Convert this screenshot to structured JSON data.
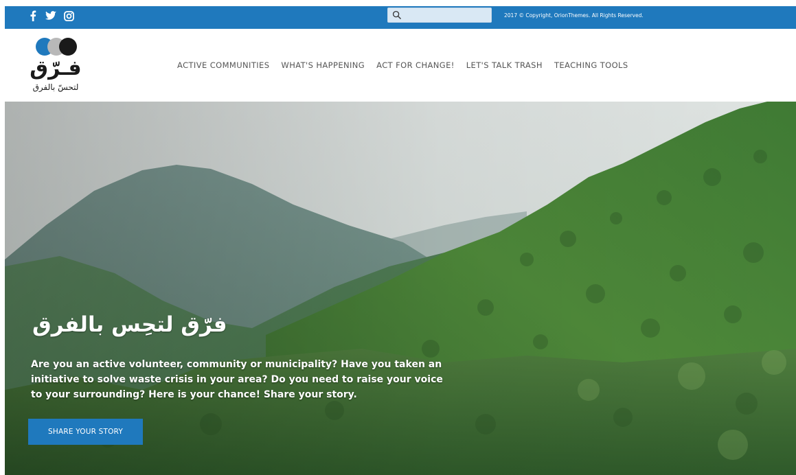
{
  "topbar": {
    "social": [
      {
        "icon": "facebook-icon",
        "glyph": "f"
      },
      {
        "icon": "twitter-icon",
        "glyph": ""
      },
      {
        "icon": "instagram-icon",
        "glyph": ""
      }
    ],
    "search": {
      "placeholder": "",
      "value": ""
    },
    "copyright": "2017 © Copyright, OrionThemes. All Rights Reserved."
  },
  "logo": {
    "title": "فـرّق",
    "subtitle": "لتحسّ بالفرق",
    "dot_colors": [
      "#1f79bd",
      "#b0b0b0",
      "#1a1a1a"
    ]
  },
  "nav": {
    "items": [
      "ACTIVE COMMUNITIES",
      "WHAT'S HAPPENING",
      "ACT FOR CHANGE!",
      "LET'S TALK TRASH",
      "TEACHING TOOLS"
    ]
  },
  "hero": {
    "title": "فرّق لتحِس بالفرق",
    "text": "Are you an active volunteer, community or municipality? Have you taken an initiative to solve waste crisis in your area? Do you need to raise your voice to your surrounding? Here is your chance! Share your story.",
    "cta_label": "SHARE YOUR STORY"
  },
  "colors": {
    "accent": "#1f79bd",
    "white": "#ffffff"
  }
}
